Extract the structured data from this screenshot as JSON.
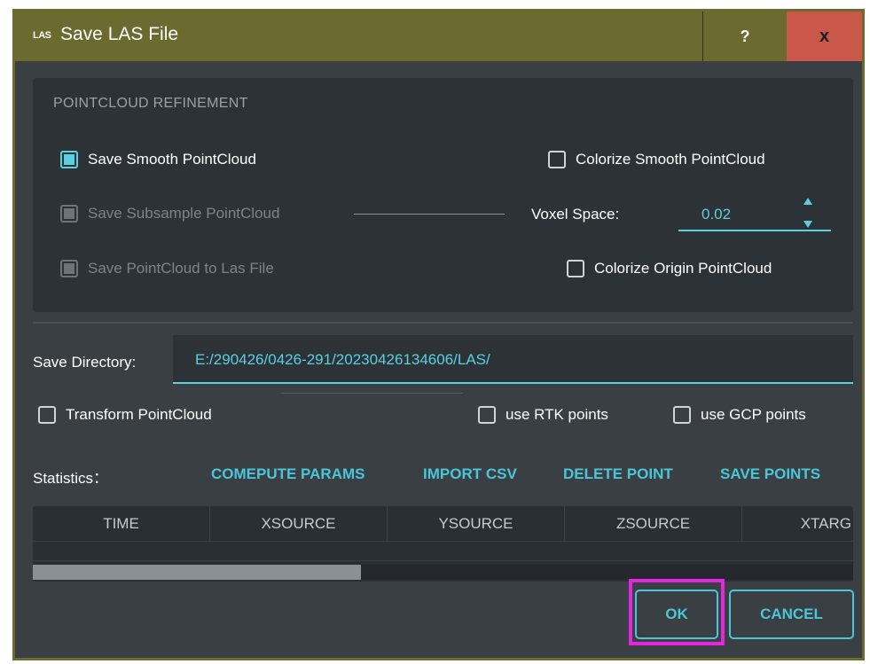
{
  "window": {
    "icon_text": "LAS",
    "title": "Save LAS File",
    "help_label": "?",
    "close_label": "x"
  },
  "refinement": {
    "section_title": "POINTCLOUD REFINEMENT",
    "save_smooth": "Save Smooth PointCloud",
    "colorize_smooth": "Colorize Smooth PointCloud",
    "save_subsample": "Save Subsample PointCloud",
    "voxel_label": "Voxel Space:",
    "voxel_value": "0.02",
    "save_to_las": "Save PointCloud to Las File",
    "colorize_origin": "Colorize Origin PointCloud"
  },
  "directory": {
    "label": "Save Directory:",
    "value": "E:/290426/0426-291/20230426134606/LAS/"
  },
  "options": {
    "transform": "Transform PointCloud",
    "use_rtk": "use RTK points",
    "use_gcp": "use GCP points"
  },
  "statistics": {
    "label": "Statistics：",
    "compute": "COMEPUTE PARAMS",
    "import_csv": "IMPORT CSV",
    "delete_point": "DELETE POINT",
    "save_points": "SAVE POINTS"
  },
  "table": {
    "columns": [
      "TIME",
      "XSOURCE",
      "YSOURCE",
      "ZSOURCE",
      "XTARG"
    ],
    "scroll_fraction": 0.4
  },
  "buttons": {
    "ok": "OK",
    "cancel": "CANCEL"
  },
  "colors": {
    "accent": "#49c6d8",
    "title_bar": "#6b6b2f",
    "close_button": "#c9574a",
    "highlight": "#e426e0"
  }
}
